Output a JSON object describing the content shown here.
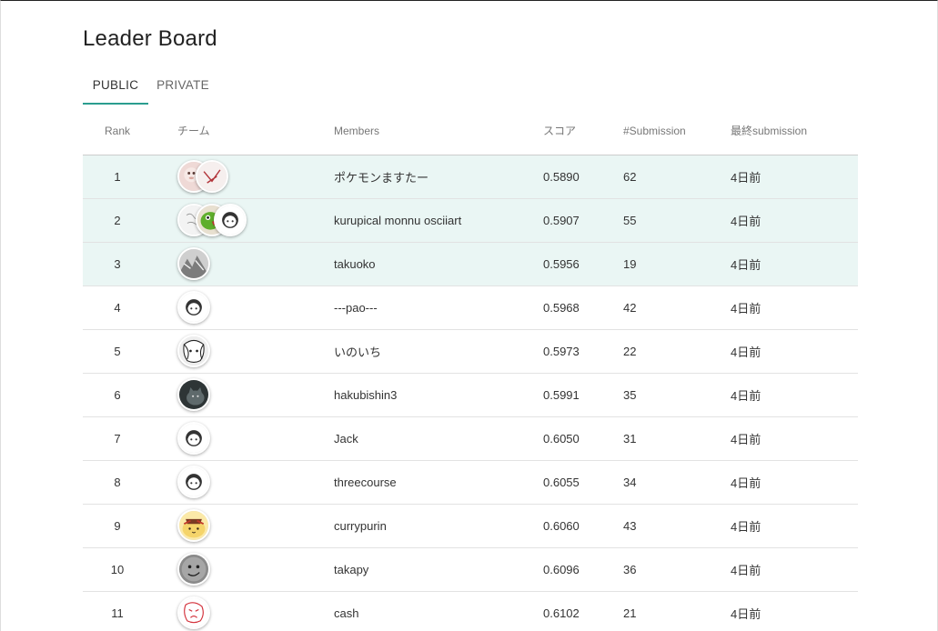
{
  "page": {
    "title": "Leader Board"
  },
  "tabs": [
    {
      "label": "PUBLIC",
      "active": true
    },
    {
      "label": "PRIVATE",
      "active": false
    }
  ],
  "columns": {
    "rank": "Rank",
    "team": "チーム",
    "members": "Members",
    "score": "スコア",
    "submissions": "#Submission",
    "last": "最終submission"
  },
  "colors": {
    "accent": "#2a9d8f",
    "highlight_row": "#eaf6f4"
  },
  "rows": [
    {
      "rank": "1",
      "avatars": [
        "pink-face-icon",
        "pink-sketch-icon"
      ],
      "members": "ポケモンますたー",
      "score": "0.5890",
      "submissions": "62",
      "last": "4日前",
      "highlight": true
    },
    {
      "rank": "2",
      "avatars": [
        "sketch-icon",
        "green-bird-icon",
        "default-user-icon"
      ],
      "members": "kurupical monnu osciiart",
      "score": "0.5907",
      "submissions": "55",
      "last": "4日前",
      "highlight": true
    },
    {
      "rank": "3",
      "avatars": [
        "grey-photo-icon"
      ],
      "members": "takuoko",
      "score": "0.5956",
      "submissions": "19",
      "last": "4日前",
      "highlight": true
    },
    {
      "rank": "4",
      "avatars": [
        "default-user-icon"
      ],
      "members": "---pao---",
      "score": "0.5968",
      "submissions": "42",
      "last": "4日前",
      "highlight": false
    },
    {
      "rank": "5",
      "avatars": [
        "manga-face-icon"
      ],
      "members": "いのいち",
      "score": "0.5973",
      "submissions": "22",
      "last": "4日前",
      "highlight": false
    },
    {
      "rank": "6",
      "avatars": [
        "cat-photo-icon"
      ],
      "members": "hakubishin3",
      "score": "0.5991",
      "submissions": "35",
      "last": "4日前",
      "highlight": false
    },
    {
      "rank": "7",
      "avatars": [
        "default-user-icon"
      ],
      "members": "Jack",
      "score": "0.6050",
      "submissions": "31",
      "last": "4日前",
      "highlight": false
    },
    {
      "rank": "8",
      "avatars": [
        "default-user-icon"
      ],
      "members": "threecourse",
      "score": "0.6055",
      "submissions": "34",
      "last": "4日前",
      "highlight": false
    },
    {
      "rank": "9",
      "avatars": [
        "pompompurin-icon"
      ],
      "members": "currypurin",
      "score": "0.6060",
      "submissions": "43",
      "last": "4日前",
      "highlight": false
    },
    {
      "rank": "10",
      "avatars": [
        "grey-face-icon"
      ],
      "members": "takapy",
      "score": "0.6096",
      "submissions": "36",
      "last": "4日前",
      "highlight": false
    },
    {
      "rank": "11",
      "avatars": [
        "red-sketch-icon"
      ],
      "members": "cash",
      "score": "0.6102",
      "submissions": "21",
      "last": "4日前",
      "highlight": false
    }
  ]
}
